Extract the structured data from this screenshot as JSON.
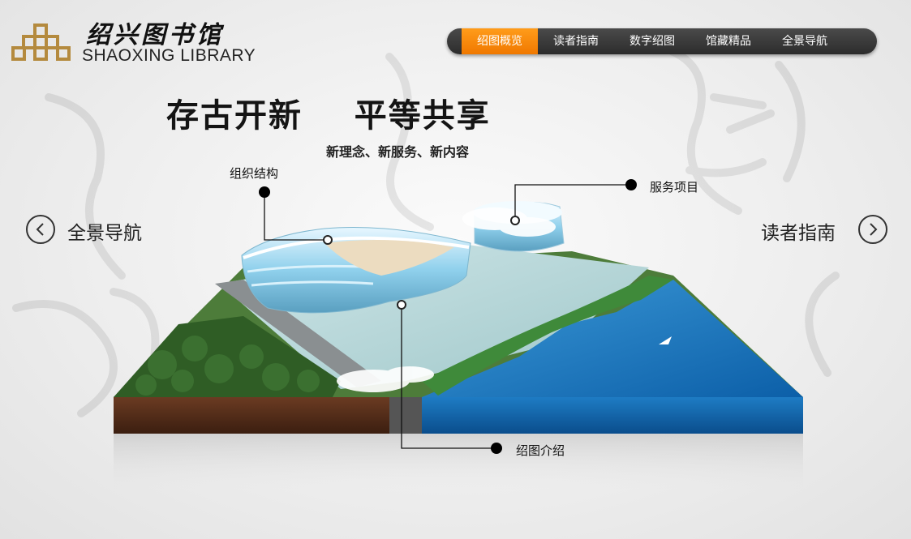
{
  "logo": {
    "name_cn": "绍兴图书馆",
    "name_en": "SHAOXING LIBRARY",
    "icon": "library-emblem-icon"
  },
  "nav": {
    "items": [
      {
        "label": "绍图概览",
        "active": true
      },
      {
        "label": "读者指南",
        "active": false
      },
      {
        "label": "数字绍图",
        "active": false
      },
      {
        "label": "馆藏精品",
        "active": false
      },
      {
        "label": "全景导航",
        "active": false
      }
    ],
    "active_color": "#f38200"
  },
  "hero": {
    "slogan": "存古开新    平等共享",
    "subslogan": "新理念、新服务、新内容"
  },
  "side_nav": {
    "left_label": "全景导航",
    "right_label": "读者指南",
    "left_icon": "chevron-left-icon",
    "right_icon": "chevron-right-icon"
  },
  "callouts": {
    "org_structure": "组织结构",
    "services": "服务项目",
    "intro": "绍图介绍"
  }
}
